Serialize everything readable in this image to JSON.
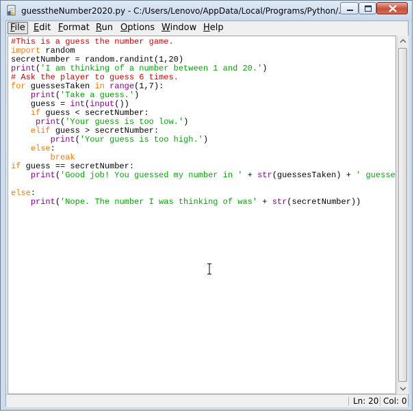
{
  "window": {
    "title": "guesstheNumber2020.py - C:/Users/Lenovo/AppData/Local/Programs/Python/..."
  },
  "menu": {
    "items": [
      {
        "label": "File",
        "underline": "F",
        "rest": "ile"
      },
      {
        "label": "Edit",
        "underline": "E",
        "rest": "dit"
      },
      {
        "label": "Format",
        "underline": "F",
        "rest": "ormat"
      },
      {
        "label": "Run",
        "underline": "R",
        "rest": "un"
      },
      {
        "label": "Options",
        "underline": "O",
        "rest": "ptions"
      },
      {
        "label": "Window",
        "underline": "W",
        "rest": "indow"
      },
      {
        "label": "Help",
        "underline": "H",
        "rest": "elp"
      }
    ]
  },
  "editor": {
    "lines": [
      [
        [
          "cm",
          "#This is a guess the number game."
        ]
      ],
      [
        [
          "kw",
          "import"
        ],
        [
          "",
          " random"
        ]
      ],
      [
        [
          "",
          "secretNumber = random.randint(1,20)"
        ]
      ],
      [
        [
          "bi",
          "print"
        ],
        [
          "",
          "("
        ],
        [
          "st",
          "'I am thinking of a number between 1 and 20.'"
        ],
        [
          "",
          ")"
        ]
      ],
      [
        [
          "cm",
          "# Ask the player to guess 6 times."
        ]
      ],
      [
        [
          "kw",
          "for"
        ],
        [
          "",
          " guessesTaken "
        ],
        [
          "kw",
          "in"
        ],
        [
          "",
          " "
        ],
        [
          "bi",
          "range"
        ],
        [
          "",
          "(1,7):"
        ]
      ],
      [
        [
          "",
          "    "
        ],
        [
          "bi",
          "print"
        ],
        [
          "",
          "("
        ],
        [
          "st",
          "'Take a guess.'"
        ],
        [
          "",
          ")"
        ]
      ],
      [
        [
          "",
          "    guess = "
        ],
        [
          "bi",
          "int"
        ],
        [
          "",
          "("
        ],
        [
          "bi",
          "input"
        ],
        [
          "",
          "())"
        ]
      ],
      [
        [
          "",
          "    "
        ],
        [
          "kw",
          "if"
        ],
        [
          "",
          " guess < secretNumber:"
        ]
      ],
      [
        [
          "",
          "     "
        ],
        [
          "bi",
          "print"
        ],
        [
          "",
          "("
        ],
        [
          "st",
          "'Your guess is too low.'"
        ],
        [
          "",
          ")"
        ]
      ],
      [
        [
          "",
          "    "
        ],
        [
          "kw",
          "elif"
        ],
        [
          "",
          " guess > secretNumber:"
        ]
      ],
      [
        [
          "",
          "        "
        ],
        [
          "bi",
          "print"
        ],
        [
          "",
          "("
        ],
        [
          "st",
          "'Your guess is too high.'"
        ],
        [
          "",
          ")"
        ]
      ],
      [
        [
          "",
          "    "
        ],
        [
          "kw",
          "else"
        ],
        [
          "",
          ":"
        ]
      ],
      [
        [
          "",
          "        "
        ],
        [
          "kw",
          "break"
        ]
      ],
      [
        [
          "kw",
          "if"
        ],
        [
          "",
          " guess == secretNumber:"
        ]
      ],
      [
        [
          "",
          "    "
        ],
        [
          "bi",
          "print"
        ],
        [
          "",
          "("
        ],
        [
          "st",
          "'Good job! You guessed my number in '"
        ],
        [
          "",
          " + "
        ],
        [
          "bi",
          "str"
        ],
        [
          "",
          "(guessesTaken) + "
        ],
        [
          "st",
          "' guesses!"
        ]
      ],
      [
        [
          "",
          ""
        ]
      ],
      [
        [
          "kw",
          "else"
        ],
        [
          "",
          ":"
        ]
      ],
      [
        [
          "",
          "    "
        ],
        [
          "bi",
          "print"
        ],
        [
          "",
          "("
        ],
        [
          "st",
          "'Nope. The number I was thinking of was'"
        ],
        [
          "",
          " + "
        ],
        [
          "bi",
          "str"
        ],
        [
          "",
          "(secretNumber))"
        ]
      ]
    ]
  },
  "status": {
    "ln": "Ln: 20",
    "col": "Col: 0"
  },
  "colors": {
    "keyword": "#ff7700",
    "comment": "#dd0000",
    "string": "#00aa00",
    "builtin": "#900090"
  }
}
